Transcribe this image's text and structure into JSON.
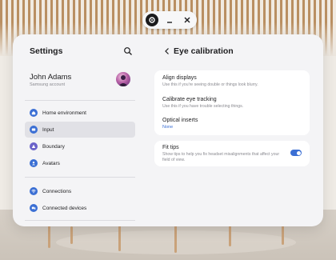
{
  "colors": {
    "accent": "#3b6fd4",
    "window_bg": "#f4f4f6",
    "card_bg": "#ffffff",
    "text_primary": "#1e1e20",
    "text_secondary": "#8a8a90",
    "nav_active_bg": "#e1e1e6"
  },
  "top_bar": {
    "icons": [
      "app-icon",
      "minimize-icon",
      "close-icon"
    ]
  },
  "left_panel": {
    "title": "Settings",
    "search_icon": "search-icon",
    "profile": {
      "name": "John Adams",
      "subtitle": "Samsung account"
    },
    "nav_groups": [
      [
        {
          "label": "Home environment",
          "icon": "home-icon",
          "color": "#3b6fd4"
        },
        {
          "label": "Input",
          "icon": "input-icon",
          "color": "#3b6fd4",
          "active": true
        },
        {
          "label": "Boundary",
          "icon": "boundary-icon",
          "color": "#6a62c9"
        },
        {
          "label": "Avatars",
          "icon": "avatar-icon",
          "color": "#3b6fd4"
        }
      ],
      [
        {
          "label": "Connections",
          "icon": "wifi-icon",
          "color": "#3b6fd4"
        },
        {
          "label": "Connected devices",
          "icon": "devices-icon",
          "color": "#3b6fd4"
        }
      ]
    ]
  },
  "right_panel": {
    "title": "Eye calibration",
    "back_icon": "back-arrow-icon",
    "card1": [
      {
        "title": "Align displays",
        "subtitle": "Use this if you're seeing double or things look blurry."
      },
      {
        "title": "Calibrate eye tracking",
        "subtitle": "Use this if you have trouble selecting things."
      },
      {
        "title": "Optical inserts",
        "value": "None"
      }
    ],
    "card2": {
      "title": "Fit tips",
      "subtitle_line1": "Show tips to help you fix headset misalignments that affect your",
      "subtitle_line2": "field of view.",
      "toggle_on": true
    }
  }
}
